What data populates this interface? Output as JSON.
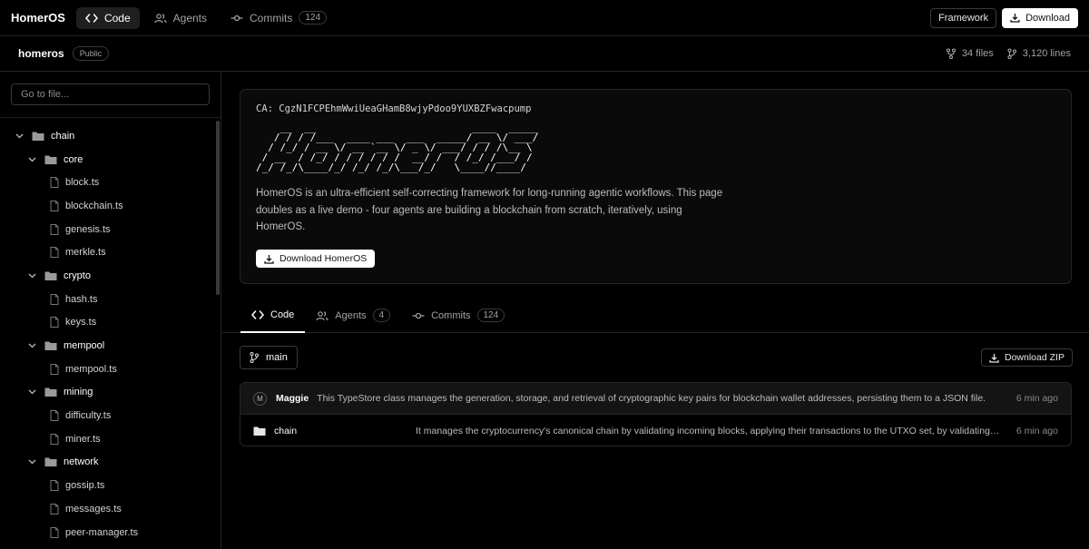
{
  "app": {
    "brand": "HomerOS",
    "tabs": [
      {
        "label": "Code",
        "icon": "code-icon",
        "active": true
      },
      {
        "label": "Agents",
        "icon": "users-icon"
      },
      {
        "label": "Commits",
        "icon": "commit-icon",
        "count": "124"
      }
    ],
    "framework_button": "Framework",
    "download_button": "Download"
  },
  "repo": {
    "name": "homeros",
    "visibility": "Public",
    "files": "34 files",
    "lines": "3,120 lines"
  },
  "sidebar": {
    "search_placeholder": "Go to file...",
    "tree": [
      {
        "type": "folder",
        "name": "chain",
        "level": 0
      },
      {
        "type": "folder",
        "name": "core",
        "level": 1
      },
      {
        "type": "file",
        "name": "block.ts",
        "level": 2
      },
      {
        "type": "file",
        "name": "blockchain.ts",
        "level": 2
      },
      {
        "type": "file",
        "name": "genesis.ts",
        "level": 2
      },
      {
        "type": "file",
        "name": "merkle.ts",
        "level": 2
      },
      {
        "type": "folder",
        "name": "crypto",
        "level": 1
      },
      {
        "type": "file",
        "name": "hash.ts",
        "level": 2
      },
      {
        "type": "file",
        "name": "keys.ts",
        "level": 2
      },
      {
        "type": "folder",
        "name": "mempool",
        "level": 1
      },
      {
        "type": "file",
        "name": "mempool.ts",
        "level": 2
      },
      {
        "type": "folder",
        "name": "mining",
        "level": 1
      },
      {
        "type": "file",
        "name": "difficulty.ts",
        "level": 2
      },
      {
        "type": "file",
        "name": "miner.ts",
        "level": 2
      },
      {
        "type": "folder",
        "name": "network",
        "level": 1
      },
      {
        "type": "file",
        "name": "gossip.ts",
        "level": 2
      },
      {
        "type": "file",
        "name": "messages.ts",
        "level": 2
      },
      {
        "type": "file",
        "name": "peer-manager.ts",
        "level": 2
      }
    ]
  },
  "readme": {
    "ca": "CA: CgzN1FCPEhmWwiUeaGHamB8wjyPdoo9YUXBZFwacpump",
    "ascii_logo": "    __  __                          ____  _____\n   / / / /___  ____ ___  ___  _____/ __ \\/ ___/\n  / /_/ / __ \\/ __ `__ \\/ _ \\/ ___/ / / /\\__ \\ \n / __  / /_/ / / / / / /  __/ /  / /_/ /___/ / \n/_/ /_/\\____/_/ /_/ /_/\\___/_/   \\____//____/  ",
    "description": "HomerOS is an ultra-efficient self-correcting framework for long-running agentic workflows. This page doubles as a live demo - four agents are building a blockchain from scratch, iteratively, using HomerOS.",
    "download_label": "Download HomerOS"
  },
  "repo_tabs": [
    {
      "label": "Code",
      "icon": "code-icon",
      "active": true
    },
    {
      "label": "Agents",
      "icon": "users-icon",
      "count": "4"
    },
    {
      "label": "Commits",
      "icon": "commit-icon",
      "count": "124"
    }
  ],
  "branch": "main",
  "download_zip": "Download ZIP",
  "latest_commit": {
    "avatar": "M",
    "author": "Maggie",
    "message": "This TypeStore class manages the generation, storage, and retrieval of cryptographic key pairs for blockchain wallet addresses, persisting them to a JSON file.",
    "time": "6 min ago"
  },
  "files": [
    {
      "name": "chain",
      "message": "It manages the cryptocurrency's canonical chain by validating incoming blocks, applying their transactions to the UTXO set, by validating and applying each block.",
      "time": "6 min ago"
    }
  ]
}
